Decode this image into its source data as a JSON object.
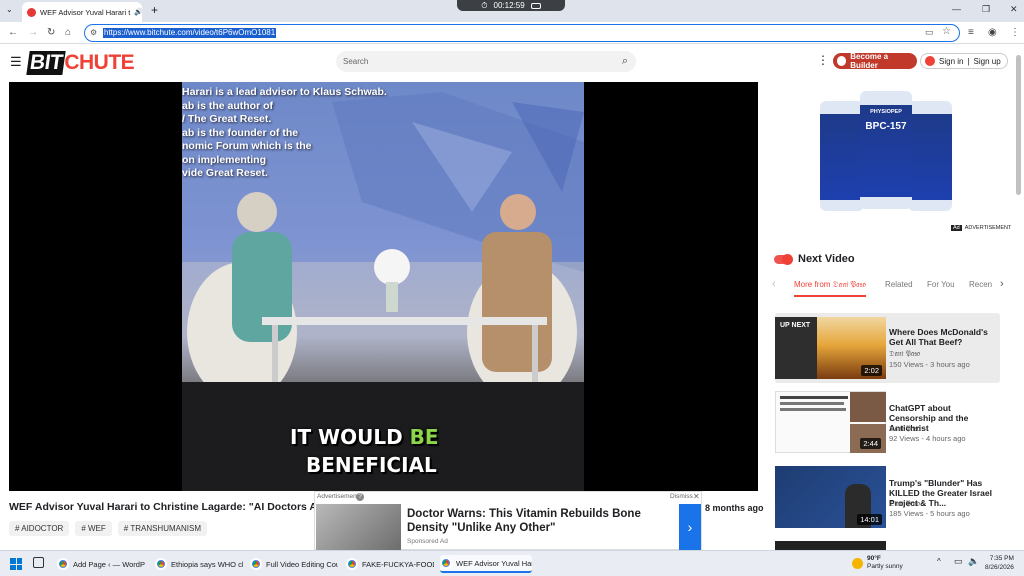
{
  "browser": {
    "tab_title": "WEF Advisor Yuval Harari t",
    "timer": "00:12:59",
    "url": "https://www.bitchute.com/video/t6P6wOmO1081",
    "new_tab": "+",
    "minimize": "—",
    "maximize": "❐",
    "close": "✕"
  },
  "site": {
    "logo_bit": "BIT",
    "logo_chute": "CHUTE",
    "search_placeholder": "Search",
    "builder_label": "Become a Builder",
    "signin_label": "Sign in",
    "signup_label": "Sign up",
    "divider": "|"
  },
  "video": {
    "overlay_lines": [
      "Harari is a lead advisor to Klaus Schwab.",
      "ab is the author of",
      "/ The Great Reset.",
      "ab is the founder of the",
      "nomic Forum which is the",
      "on implementing",
      "vide Great Reset."
    ],
    "caption_line1_a": "IT WOULD ",
    "caption_line1_b": "BE",
    "caption_line2": "BENEFICIAL",
    "title": "WEF Advisor Yuval Harari to Christine Lagarde: \"AI Doctors Are Comi",
    "ago": "8 months ago",
    "tags": [
      "AIDOCTOR",
      "WEF",
      "TRANSHUMANISM"
    ]
  },
  "ad": {
    "label": "Advertisement",
    "dismiss": "Dismiss",
    "headline": "Doctor Warns: This Vitamin Rebuilds Bone Density \"Unlike Any Other\"",
    "sponsored": "Sponsored Ad",
    "info_icon": "?",
    "close_icon": "✕",
    "arrow": "›"
  },
  "sidebar": {
    "banner_text": "BPC-157",
    "banner_brand": "PHYSIOPEP",
    "ad_badge": "Ad",
    "ad_label": "ADVERTISEMENT",
    "next_video": "Next Video",
    "tabs": [
      "More from 𝔇𝔞𝔫𝔦 𝔓𝔞𝔰𝔬",
      "Related",
      "For You",
      "Recen"
    ],
    "related": [
      {
        "badge": "UP NEXT",
        "thumb_text": "Where Does\nnald's Get All That Beef?",
        "title": "Where Does McDonald's Get All That Beef?",
        "channel": "𝔇𝔞𝔫𝔦 𝔓𝔞𝔰𝔬",
        "meta": "150 Views - 3 hours ago",
        "duration": "2:02"
      },
      {
        "title": "ChatGPT about Censorship and the Antichrist",
        "channel": "𝔇𝔞𝔫𝔦 𝔓𝔞𝔰𝔬",
        "meta": "92 Views - 4 hours ago",
        "duration": "2:44"
      },
      {
        "title": "Trump's \"Blunder\" Has KILLED the Greater Israel Project & Th...",
        "channel": "𝔇𝔞𝔫𝔦 𝔓𝔞𝔰𝔬",
        "meta": "185 Views - 5 hours ago",
        "duration": "14:01"
      }
    ]
  },
  "taskbar": {
    "apps": [
      "Add Page ‹ — WordPres",
      "Ethiopia says WHO chie",
      "Full Video Editing Cours",
      "FAKE-FUCKYA-FOODS -",
      "WEF Advisor Yuval Hara"
    ],
    "weather_temp": "90°F",
    "weather_desc": "Partly sunny",
    "time": "7:35 PM",
    "date": "8/26/2026"
  },
  "colors": {
    "accent": "#ef4136",
    "chrome_blue": "#1a73e8"
  }
}
